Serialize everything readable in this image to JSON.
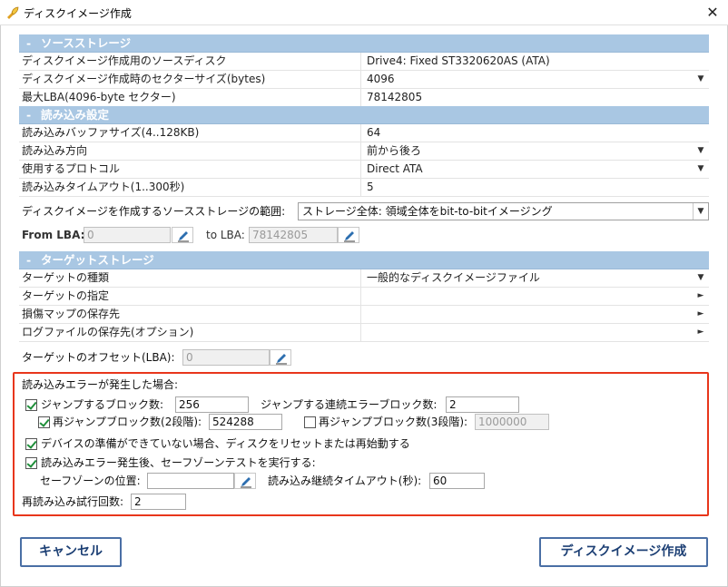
{
  "window": {
    "title": "ディスクイメージ作成",
    "close_glyph": "✕"
  },
  "source": {
    "header": "ソースストレージ",
    "rows": [
      {
        "key": "ディスクイメージ作成用のソースディスク",
        "value": "Drive4: Fixed ST3320620AS (ATA)",
        "dropdown": false
      },
      {
        "key": "ディスクイメージ作成時のセクターサイズ(bytes)",
        "value": "4096",
        "dropdown": true
      },
      {
        "key": "最大LBA(4096-byte セクター)",
        "value": "78142805",
        "dropdown": false
      }
    ]
  },
  "read": {
    "header": "読み込み設定",
    "rows": [
      {
        "key": "読み込みバッファサイズ(4..128KB)",
        "value": "64",
        "dropdown": false
      },
      {
        "key": "読み込み方向",
        "value": "前から後ろ",
        "dropdown": true
      },
      {
        "key": "使用するプロトコル",
        "value": "Direct ATA",
        "dropdown": true
      },
      {
        "key": "読み込みタイムアウト(1..300秒)",
        "value": "5",
        "dropdown": false
      }
    ]
  },
  "range": {
    "label": "ディスクイメージを作成するソースストレージの範囲:",
    "value": "ストレージ全体: 領域全体をbit-to-bitイメージング",
    "from_label": "From LBA:",
    "from_value": "0",
    "to_label": "to LBA:",
    "to_value": "78142805"
  },
  "target": {
    "header": "ターゲットストレージ",
    "rows": [
      {
        "key": "ターゲットの種類",
        "value": "一般的なディスクイメージファイル",
        "arrow": "▼"
      },
      {
        "key": "ターゲットの指定",
        "value": "",
        "arrow": "►"
      },
      {
        "key": "損傷マップの保存先",
        "value": "",
        "arrow": "►"
      },
      {
        "key": "ログファイルの保存先(オプション)",
        "value": "",
        "arrow": "►"
      }
    ],
    "offset_label": "ターゲットのオフセット(LBA):",
    "offset_value": "0"
  },
  "error": {
    "title": "読み込みエラーが発生した場合:",
    "jump_label": "ジャンプするブロック数:",
    "jump_value": "256",
    "jump_checked": true,
    "consec_label": "ジャンプする連続エラーブロック数:",
    "consec_value": "2",
    "rejump2_label": "再ジャンプブロック数(2段階):",
    "rejump2_value": "524288",
    "rejump2_checked": true,
    "rejump3_label": "再ジャンプブロック数(3段階):",
    "rejump3_value": "1000000",
    "rejump3_checked": false,
    "reset_label": "デバイスの準備ができていない場合、ディスクをリセットまたは再始動する",
    "reset_checked": true,
    "safezone_label": "読み込みエラー発生後、セーフゾーンテストを実行する:",
    "safezone_checked": true,
    "safezone_pos_label": "セーフゾーンの位置:",
    "safezone_pos_value": "",
    "continue_timeout_label": "読み込み継続タイムアウト(秒):",
    "continue_timeout_value": "60",
    "retry_label": "再読み込み試行回数:",
    "retry_value": "2"
  },
  "buttons": {
    "cancel": "キャンセル",
    "create": "ディスクイメージ作成"
  },
  "colors": {
    "section_header": "#a9c7e3",
    "highlight": "#e8361b",
    "button_border": "#4a6fa5"
  }
}
